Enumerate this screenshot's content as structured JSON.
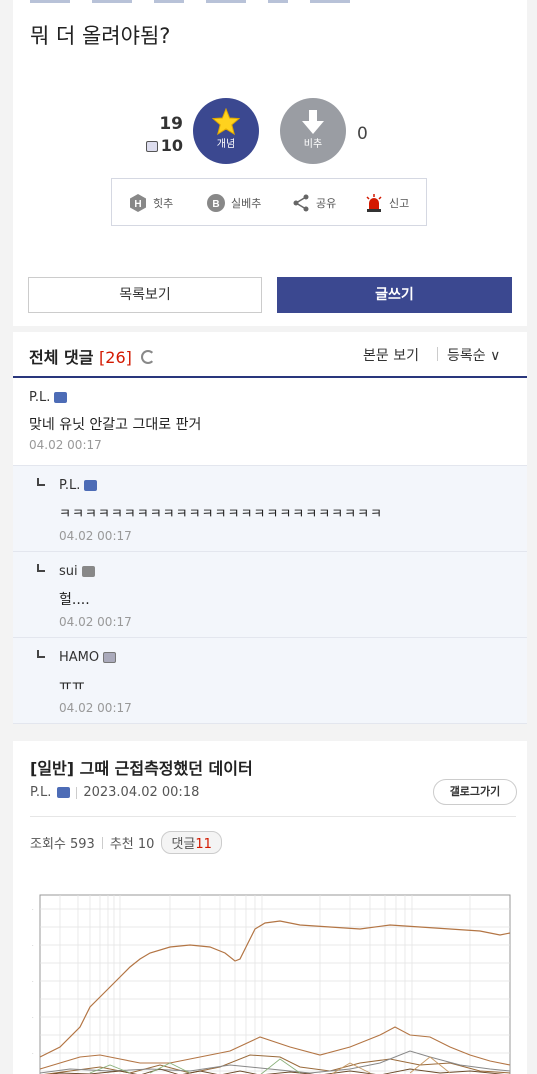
{
  "post": {
    "question": "뭐 더 올려야됨?",
    "vote": {
      "up_count": "19",
      "fix_count": "10",
      "up_label": "개념",
      "down_label": "비추",
      "down_count": "0"
    },
    "share_bar": [
      {
        "label": "힛추",
        "icon": "hit-icon"
      },
      {
        "label": "실베추",
        "icon": "best-icon"
      },
      {
        "label": "공유",
        "icon": "share-icon"
      },
      {
        "label": "신고",
        "icon": "siren-icon"
      }
    ],
    "buttons": {
      "list": "목록보기",
      "write": "글쓰기"
    }
  },
  "comments": {
    "title": "전체 댓글",
    "count": "[26]",
    "view_label": "본문 보기",
    "sort_label": "등록순",
    "items": [
      {
        "nick": "P.L.",
        "text": "맞네 유닛 안갈고 그대로 판거",
        "time": "04.02 00:17"
      },
      {
        "nick": "P.L.",
        "text": "ㅋㅋㅋㅋㅋㅋㅋㅋㅋㅋㅋㅋㅋㅋㅋㅋㅋㅋㅋㅋㅋㅋㅋㅋㅋ",
        "time": "04.02 00:17"
      },
      {
        "nick": "sui",
        "text": "헐....",
        "time": "04.02 00:17"
      },
      {
        "nick": "HAMO",
        "text": "ㅠㅠ",
        "time": "04.02 00:17"
      }
    ]
  },
  "next_post": {
    "title": "[일반] 그때 근접측정했던 데이터",
    "author": "P.L.",
    "date": "2023.04.02 00:18",
    "gallery_button": "갤로그가기",
    "views_label": "조회수 593",
    "recommend_label": "추천 10",
    "comment_label": "댓글",
    "comment_count": "11"
  },
  "colors": {
    "accent": "#3b4890",
    "down": "#9a9da3",
    "count_red": "#d31900",
    "reply_bg": "#f3f6fb"
  }
}
